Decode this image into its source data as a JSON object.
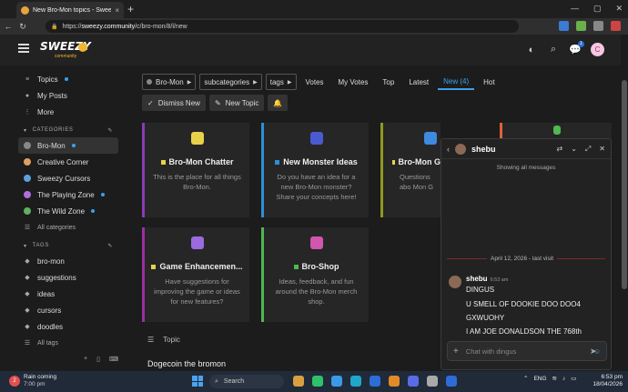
{
  "browser": {
    "tab_title": "New Bro-Mon topics - Sweezy Co...",
    "tab_close": "×",
    "new_tab": "+",
    "url_prefix": "https://",
    "url_host": "sweezy.community",
    "url_path": "/c/bro-mon/8/l/new",
    "back": "←",
    "reload": "↻",
    "min": "—",
    "max": "▢",
    "close": "✕"
  },
  "site": {
    "logo": "SWEEZY",
    "logo_sub": "community",
    "avatar_letter": "C",
    "chat_badge": "1"
  },
  "sidebar": {
    "items": [
      {
        "label": "Topics",
        "dot": true
      },
      {
        "label": "My Posts"
      },
      {
        "label": "More"
      }
    ],
    "categories_header": "CATEGORIES",
    "categories": [
      {
        "label": "Bro-Mon",
        "dot": true,
        "active": true,
        "color": "#888888"
      },
      {
        "label": "Creative Corner",
        "color": "#e0a060"
      },
      {
        "label": "Sweezy Cursors",
        "color": "#5aa0e0"
      },
      {
        "label": "The Playing Zone",
        "dot": true,
        "color": "#b070e0"
      },
      {
        "label": "The Wild Zone",
        "dot": true,
        "color": "#60b060"
      }
    ],
    "all_categories": "All categories",
    "tags_header": "TAGS",
    "tags": [
      "bro-mon",
      "suggestions",
      "ideas",
      "cursors",
      "doodles"
    ],
    "all_tags": "All tags"
  },
  "filters": {
    "category": "Bro-Mon",
    "subcategories": "subcategories",
    "tags": "tags",
    "links": [
      "Votes",
      "My Votes",
      "Top",
      "Latest",
      "New (4)",
      "Hot"
    ],
    "active_link": "New (4)"
  },
  "actions": {
    "dismiss": "Dismiss New",
    "new_topic": "New Topic"
  },
  "cards": [
    {
      "title": "Bro-Mon Chatter",
      "desc": "This is the place for all things Bro-Mon.",
      "border": "#8a3ab5",
      "sq": "#e8d24a",
      "icon": "#e8d24a"
    },
    {
      "title": "New Monster Ideas",
      "desc": "Do you have an idea for a new Bro-Mon monster? Share your concepts here!",
      "border": "#2c8fd6",
      "sq": "#2c8fd6",
      "icon": "#4a5ad0"
    },
    {
      "title": "Bro-Mon G",
      "desc": "Questions abo Mon G",
      "border": "#8f9a1e",
      "sq": "#e8d24a",
      "icon": "#3e8ae0"
    },
    {
      "title": "Game Enhancemen...",
      "desc": "Have suggestions for improving the game or ideas for new features?",
      "border": "#9a2fa5",
      "sq": "#e8d24a",
      "icon": "#9a6ae0"
    },
    {
      "title": "Bro-Shop",
      "desc": "Ideas, feedback, and fun around the Bro-Mon merch shop.",
      "border": "#4fb84f",
      "sq": "#4fb84f",
      "icon": "#d056b0"
    }
  ],
  "topic_list": {
    "header": "Topic",
    "first_topic": "Dogecoin the bromon"
  },
  "chat": {
    "name": "shebu",
    "showing": "Showing all messages",
    "date": "April 12, 2026 - last visit",
    "msg_user": "shebu",
    "msg_time": "6:53 am",
    "lines": [
      "DINGUS",
      "U SMELL OF DOOKIE DOO DOO4",
      "GXWUOHY",
      "I AM JOE DONALDSON THE 768th"
    ],
    "placeholder": "Chat with dingus"
  },
  "taskbar": {
    "weather_badge": "2",
    "weather_title": "Rain coming",
    "weather_time": "7:00 pm",
    "search": "Search",
    "lang": "ENG",
    "time": "6:53 pm",
    "date": "18/04/2026"
  }
}
